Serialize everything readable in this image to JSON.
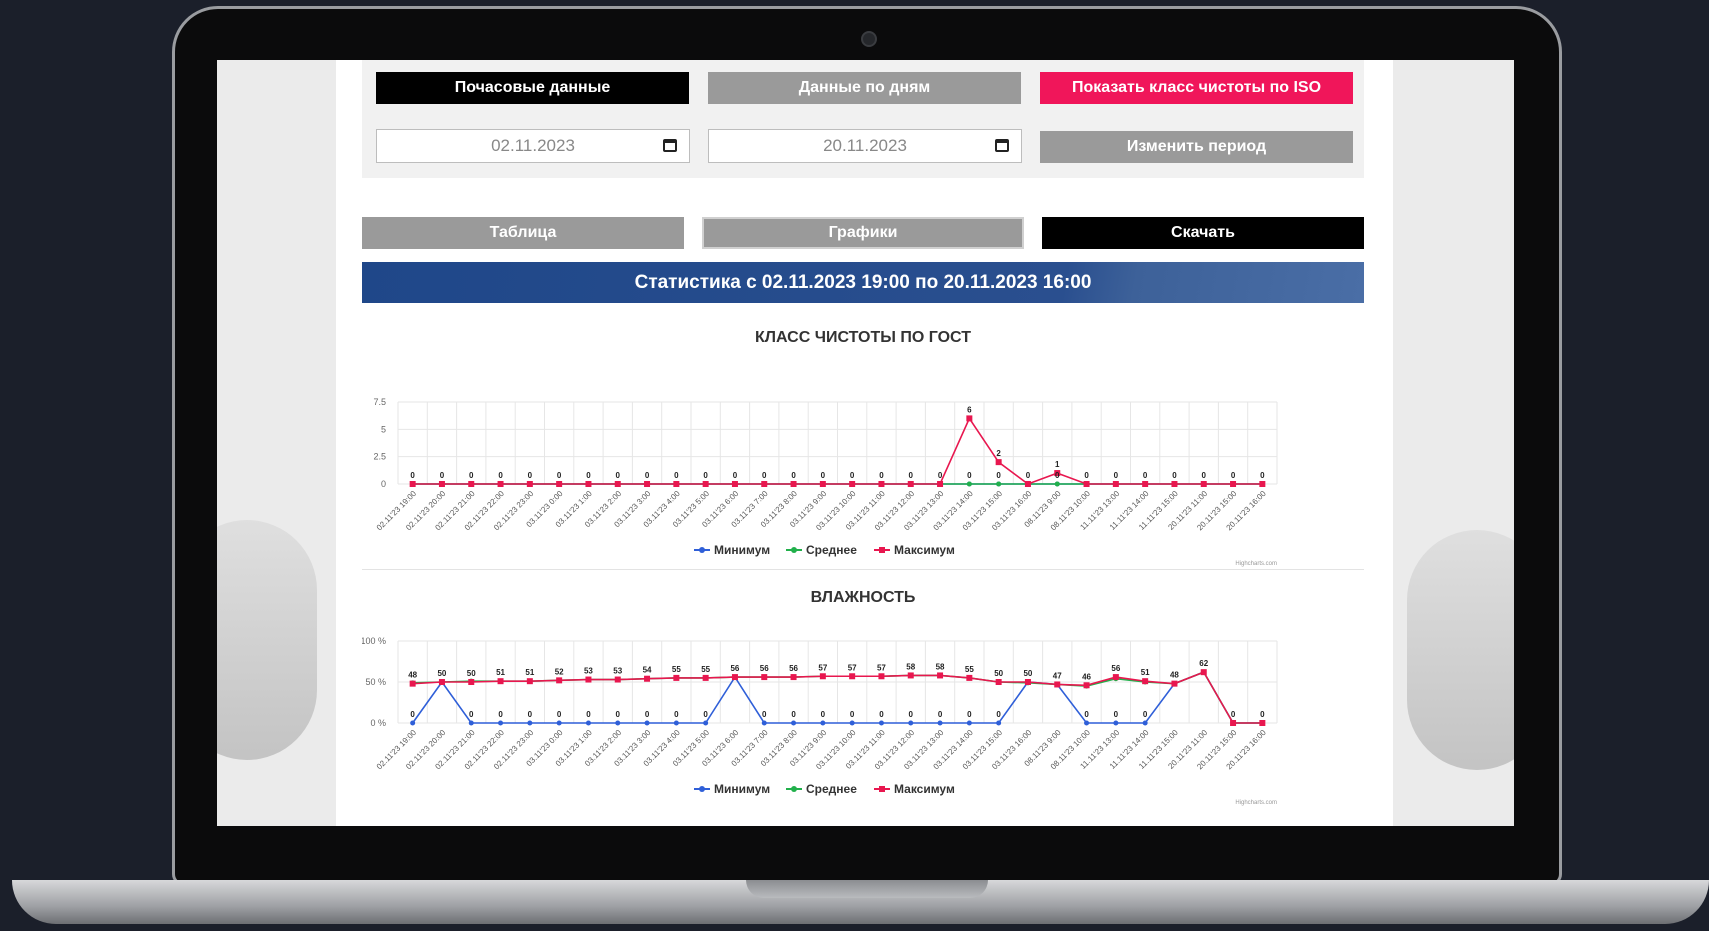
{
  "buttons": {
    "hourly": "Почасовые данные",
    "daily": "Данные по дням",
    "iso": "Показать класс чистоты по ISO",
    "change_period": "Изменить период",
    "table": "Таблица",
    "charts": "Графики",
    "download": "Скачать"
  },
  "dates": {
    "from": "02.11.2023",
    "to": "20.11.2023"
  },
  "stats_title": "Статистика с 02.11.2023 19:00 по 20.11.2023 16:00",
  "colors": {
    "min": "#2f5fd8",
    "avg": "#21b04b",
    "max": "#e8174f",
    "accent": "#f0165a",
    "header": "#1f4789"
  },
  "icons": [
    "calendar-icon",
    "calendar-icon"
  ],
  "chart_data": [
    {
      "type": "line",
      "title": "КЛАСС ЧИСТОТЫ ПО ГОСТ",
      "credits": "Highcharts.com",
      "yticks": [
        "0",
        "2.5",
        "5",
        "7.5"
      ],
      "ylim": [
        0,
        7.5
      ],
      "categories": [
        "02.11'23 19:00",
        "02.11'23 20:00",
        "02.11'23 21:00",
        "02.11'23 22:00",
        "02.11'23 23:00",
        "03.11'23 0:00",
        "03.11'23 1:00",
        "03.11'23 2:00",
        "03.11'23 3:00",
        "03.11'23 4:00",
        "03.11'23 5:00",
        "03.11'23 6:00",
        "03.11'23 7:00",
        "03.11'23 8:00",
        "03.11'23 9:00",
        "03.11'23 10:00",
        "03.11'23 11:00",
        "03.11'23 12:00",
        "03.11'23 13:00",
        "03.11'23 14:00",
        "03.11'23 15:00",
        "03.11'23 16:00",
        "08.11'23 9:00",
        "08.11'23 10:00",
        "11.11'23 13:00",
        "11.11'23 14:00",
        "11.11'23 15:00",
        "20.11'23 11:00",
        "20.11'23 15:00",
        "20.11'23 16:00"
      ],
      "series": [
        {
          "name": "Минимум",
          "values": [
            0,
            0,
            0,
            0,
            0,
            0,
            0,
            0,
            0,
            0,
            0,
            0,
            0,
            0,
            0,
            0,
            0,
            0,
            0,
            0,
            0,
            0,
            0,
            0,
            0,
            0,
            0,
            0,
            0,
            0
          ]
        },
        {
          "name": "Среднее",
          "values": [
            0,
            0,
            0,
            0,
            0,
            0,
            0,
            0,
            0,
            0,
            0,
            0,
            0,
            0,
            0,
            0,
            0,
            0,
            0,
            0,
            0,
            0,
            0,
            0,
            0,
            0,
            0,
            0,
            0,
            0
          ]
        },
        {
          "name": "Максимум",
          "values": [
            0,
            0,
            0,
            0,
            0,
            0,
            0,
            0,
            0,
            0,
            0,
            0,
            0,
            0,
            0,
            0,
            0,
            0,
            0,
            6,
            2,
            0,
            1,
            0,
            0,
            0,
            0,
            0,
            0,
            0
          ]
        }
      ],
      "labels": [
        0,
        0,
        0,
        0,
        0,
        0,
        0,
        0,
        0,
        0,
        0,
        0,
        0,
        0,
        0,
        0,
        0,
        0,
        0,
        6,
        2,
        0,
        1,
        0,
        0,
        0,
        0,
        0,
        0,
        0
      ],
      "second_labels": {
        "19": "0",
        "20": "0",
        "22": "0"
      }
    },
    {
      "type": "line",
      "title": "ВЛАЖНОСТЬ",
      "credits": "Highcharts.com",
      "yticks": [
        "0 %",
        "50 %",
        "100 %"
      ],
      "ylim": [
        0,
        100
      ],
      "categories": [
        "02.11'23 19:00",
        "02.11'23 20:00",
        "02.11'23 21:00",
        "02.11'23 22:00",
        "02.11'23 23:00",
        "03.11'23 0:00",
        "03.11'23 1:00",
        "03.11'23 2:00",
        "03.11'23 3:00",
        "03.11'23 4:00",
        "03.11'23 5:00",
        "03.11'23 6:00",
        "03.11'23 7:00",
        "03.11'23 8:00",
        "03.11'23 9:00",
        "03.11'23 10:00",
        "03.11'23 11:00",
        "03.11'23 12:00",
        "03.11'23 13:00",
        "03.11'23 14:00",
        "03.11'23 15:00",
        "03.11'23 16:00",
        "08.11'23 9:00",
        "08.11'23 10:00",
        "11.11'23 13:00",
        "11.11'23 14:00",
        "11.11'23 15:00",
        "20.11'23 11:00",
        "20.11'23 15:00",
        "20.11'23 16:00"
      ],
      "series": [
        {
          "name": "Минимум",
          "values": [
            0,
            50,
            0,
            0,
            0,
            0,
            0,
            0,
            0,
            0,
            0,
            56,
            0,
            0,
            0,
            0,
            0,
            0,
            0,
            0,
            0,
            50,
            47,
            0,
            0,
            0,
            48,
            62,
            0,
            0
          ]
        },
        {
          "name": "Среднее",
          "values": [
            49,
            50,
            51,
            51,
            51,
            52,
            53,
            53,
            54,
            55,
            55,
            56,
            56,
            56,
            57,
            57,
            57,
            58,
            58,
            55,
            50,
            49,
            47,
            45,
            54,
            50,
            48,
            62,
            0,
            0
          ]
        },
        {
          "name": "Максимум",
          "values": [
            48,
            50,
            50,
            51,
            51,
            52,
            53,
            53,
            54,
            55,
            55,
            56,
            56,
            56,
            57,
            57,
            57,
            58,
            58,
            55,
            50,
            50,
            47,
            46,
            56,
            51,
            48,
            62,
            0,
            0
          ]
        }
      ],
      "labels": [
        48,
        50,
        50,
        51,
        51,
        52,
        53,
        53,
        54,
        55,
        55,
        56,
        56,
        56,
        57,
        57,
        57,
        58,
        58,
        55,
        50,
        50,
        47,
        46,
        56,
        51,
        48,
        62,
        0,
        0
      ],
      "min_labels": {
        "0": "0",
        "2": "0",
        "3": "0",
        "4": "0",
        "5": "0",
        "6": "0",
        "7": "0",
        "8": "0",
        "9": "0",
        "10": "0",
        "12": "0",
        "13": "0",
        "14": "0",
        "15": "0",
        "16": "0",
        "17": "0",
        "18": "0",
        "19": "0",
        "20": "0",
        "23": "0",
        "24": "0",
        "25": "0"
      }
    }
  ]
}
